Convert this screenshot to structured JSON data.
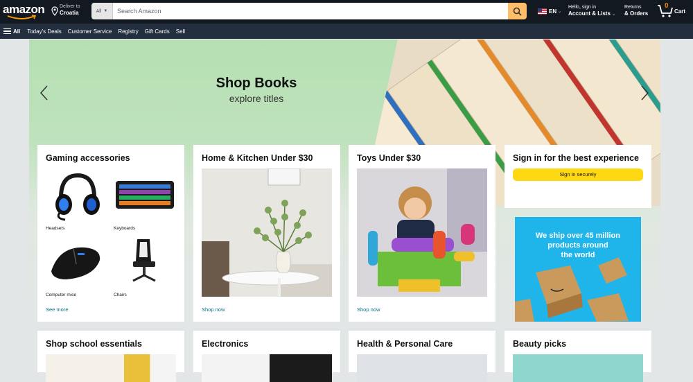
{
  "header": {
    "logo_text": "amazon",
    "deliver_small": "Deliver to",
    "deliver_big": "Croatia",
    "search_category": "All",
    "search_placeholder": "Search Amazon",
    "language": "EN",
    "account_small": "Hello, sign in",
    "account_big": "Account & Lists",
    "returns_small": "Returns",
    "returns_big": "& Orders",
    "cart_count": "0",
    "cart_label": "Cart"
  },
  "subnav": {
    "all_label": "All",
    "items": [
      "Today's Deals",
      "Customer Service",
      "Registry",
      "Gift Cards",
      "Sell"
    ]
  },
  "hero": {
    "title": "Shop Books",
    "subtitle": "explore titles"
  },
  "cards": {
    "gaming": {
      "title": "Gaming accessories",
      "tiles": [
        "Headsets",
        "Keyboards",
        "Computer mice",
        "Chairs"
      ],
      "link": "See more"
    },
    "kitchen": {
      "title": "Home & Kitchen Under $30",
      "link": "Shop now"
    },
    "toys": {
      "title": "Toys Under $30",
      "link": "Shop now"
    },
    "signin": {
      "title": "Sign in for the best experience",
      "button": "Sign in securely"
    },
    "ad": {
      "line1": "We ship over 45 million",
      "line2": "products around",
      "line3": "the world"
    },
    "row2": [
      "Shop school essentials",
      "Electronics",
      "Health & Personal Care",
      "Beauty picks"
    ]
  },
  "colors": {
    "header_bg": "#131921",
    "subnav_bg": "#232f3e",
    "search_button": "#febd69",
    "signin_button": "#ffd814",
    "link": "#007185",
    "ad_bg": "#1fb5eb"
  }
}
